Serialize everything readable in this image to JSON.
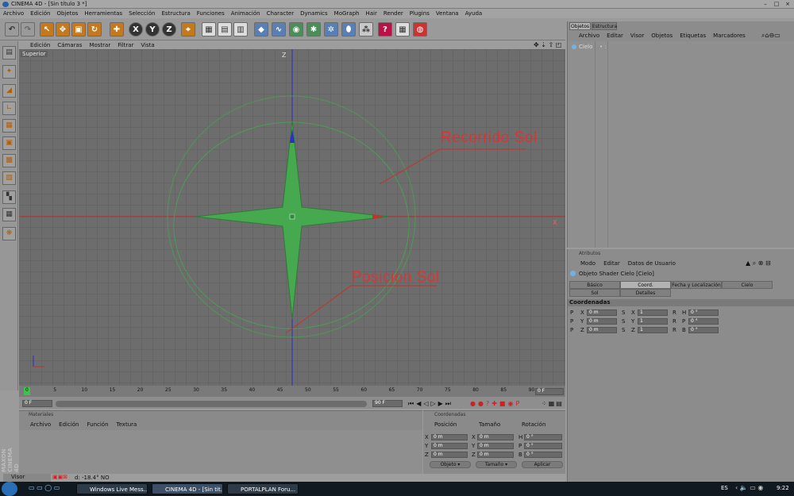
{
  "window": {
    "title": "CINEMA 4D - [Sin título 3 *]"
  },
  "menu": [
    "Archivo",
    "Edición",
    "Objetos",
    "Herramientas",
    "Selección",
    "Estructura",
    "Funciones",
    "Animación",
    "Character",
    "Dynamics",
    "MoGraph",
    "Hair",
    "Render",
    "Plugins",
    "Ventana",
    "Ayuda"
  ],
  "toolbar": {
    "x_label": "X",
    "y_label": "Y",
    "z_label": "Z"
  },
  "viewport": {
    "menu": [
      "Edición",
      "Cámaras",
      "Mostrar",
      "Filtrar",
      "Vista"
    ],
    "view_name": "Superior",
    "axis_z": "Z",
    "axis_x": "X",
    "annot_recorrido": "Recorrido Sol",
    "annot_posicion": "Posicion Sol",
    "colors": {
      "grid": "#5d5d5d",
      "bg": "#6d6d6d",
      "green": "#46a84f",
      "red": "#c8302a",
      "blue": "#2b2bd0"
    }
  },
  "timeline": {
    "ticks": [
      "0",
      "5",
      "10",
      "15",
      "20",
      "25",
      "30",
      "35",
      "40",
      "45",
      "50",
      "55",
      "60",
      "65",
      "70",
      "75",
      "80",
      "85",
      "90"
    ],
    "current_frame": "0 F",
    "start_frame": "0 F",
    "end_frame": "90 F",
    "end_marker": "90 F"
  },
  "materials": {
    "title": "Materiales",
    "menu": [
      "Archivo",
      "Edición",
      "Función",
      "Textura"
    ]
  },
  "coords": {
    "title": "Coordenadas",
    "headers": [
      "Posición",
      "Tamaño",
      "Rotación"
    ],
    "rows": [
      {
        "a": "X",
        "pos": "0 m",
        "b": "X",
        "size": "0 m",
        "c": "H",
        "rot": "0 °"
      },
      {
        "a": "Y",
        "pos": "0 m",
        "b": "Y",
        "size": "0 m",
        "c": "P",
        "rot": "0 °"
      },
      {
        "a": "Z",
        "pos": "0 m",
        "b": "Z",
        "size": "0 m",
        "c": "B",
        "rot": "0 °"
      }
    ],
    "sel1": "Objeto",
    "sel2": "Tamaño",
    "apply": "Aplicar"
  },
  "objects": {
    "tabs": [
      "Objetos",
      "Estructura"
    ],
    "menu": [
      "Archivo",
      "Editar",
      "Visor",
      "Objetos",
      "Etiquetas",
      "Marcadores"
    ],
    "items": [
      {
        "name": "Cielo"
      }
    ]
  },
  "attributes": {
    "title": "Atributos",
    "menu": [
      "Modo",
      "Editar",
      "Datos de Usuario"
    ],
    "object_name": "Objeto Shader Cielo [Cielo]",
    "tabs_row1": [
      "Básico",
      "Coord.",
      "Fecha y Localización",
      "Cielo"
    ],
    "tabs_row2": [
      "Sol",
      "Detalles"
    ],
    "section": "Coordenadas",
    "rows": [
      {
        "p": "P",
        "pa": "X",
        "pv": "0 m",
        "s": "S",
        "sa": "X",
        "sv": "1",
        "r": "R",
        "ra": "H",
        "rv": "0 °"
      },
      {
        "p": "P",
        "pa": "Y",
        "pv": "0 m",
        "s": "S",
        "sa": "Y",
        "sv": "1",
        "r": "R",
        "ra": "P",
        "rv": "0 °"
      },
      {
        "p": "P",
        "pa": "Z",
        "pv": "0 m",
        "s": "S",
        "sa": "Z",
        "sv": "1",
        "r": "R",
        "ra": "B",
        "rv": "0 °"
      }
    ]
  },
  "status": {
    "visor": "Visor",
    "text": "d: -18.4° NO"
  },
  "taskbar": {
    "items": [
      "Windows Live Mess...",
      "CINEMA 4D - [Sin tit...",
      "PORTALPLAN Foru..."
    ],
    "lang": "ES",
    "time": "9:22"
  },
  "brand": "MAXON CINEMA 4D"
}
